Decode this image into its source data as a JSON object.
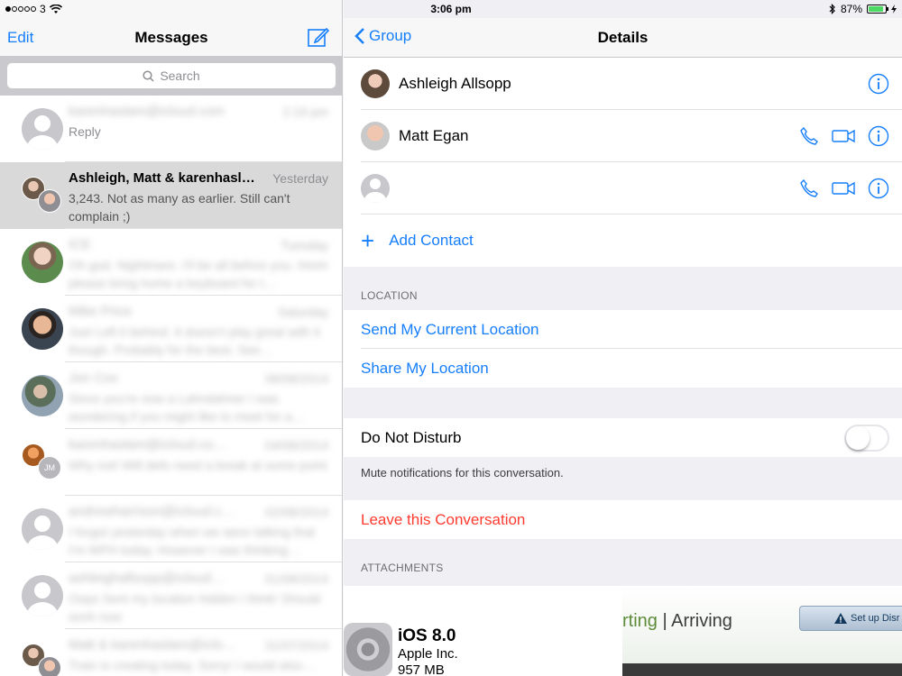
{
  "status": {
    "carrier": "3",
    "time": "3:06 pm",
    "battery": "87%",
    "battery_level": 0.87
  },
  "left_nav": {
    "edit": "Edit",
    "title": "Messages"
  },
  "search": {
    "placeholder": "Search"
  },
  "conversations": [
    {
      "name": "karenhaslam@icloud.com",
      "time": "2:19 pm",
      "preview": "Reply",
      "blurred_name": true,
      "blurred_preview": false,
      "avatar": "placeholder"
    },
    {
      "name": "Ashleigh, Matt & karenhasl…",
      "time": "Yesterday",
      "preview": "3,243. Not as many as earlier. Still can't complain ;)",
      "blurred_name": false,
      "blurred_preview": false,
      "avatar": "group"
    },
    {
      "name": "ICE",
      "time": "Tuesday",
      "preview": "Oh god. Nightmare. I'll be all before you. Hmm please bring home a keyboard for t…",
      "blurred_name": true,
      "blurred_preview": true,
      "avatar": "photo1"
    },
    {
      "name": "Mike Price",
      "time": "Saturday",
      "preview": "Just Left it behind. It doesn't play great with it though. Probably for the best. See…",
      "blurred_name": true,
      "blurred_preview": true,
      "avatar": "photo2"
    },
    {
      "name": "Jon Cox",
      "time": "06/08/2014",
      "preview": "Since you're now a Lahndahner I was wondering if you might like to meet for a…",
      "blurred_name": true,
      "blurred_preview": true,
      "avatar": "photo3"
    },
    {
      "name": "karenhaslam@icloud.co…",
      "time": "04/08/2014",
      "preview": "Why not! Will defo need a break at some point",
      "blurred_name": true,
      "blurred_preview": true,
      "avatar": "group-jm",
      "initials": "JM"
    },
    {
      "name": "andrewharrison@icloud.c…",
      "time": "02/08/2014",
      "preview": "I forgot yesterday when we were talking that I'm WFH today. However I was thinking…",
      "blurred_name": true,
      "blurred_preview": true,
      "avatar": "placeholder"
    },
    {
      "name": "ashleighallsopp@icloud…",
      "time": "01/08/2014",
      "preview": "Oops Sent my location hidden I think! Should work now",
      "blurred_name": true,
      "blurred_preview": true,
      "avatar": "placeholder"
    },
    {
      "name": "Matt & karenhaslam@iclo…",
      "time": "31/07/2014",
      "preview": "Train is creating today. Sorry! I would also…",
      "blurred_name": true,
      "blurred_preview": true,
      "avatar": "group"
    }
  ],
  "right_nav": {
    "back": "Group",
    "title": "Details"
  },
  "contacts": [
    {
      "name": "Ashleigh Allsopp",
      "avatar": "a1",
      "show_call": false
    },
    {
      "name": "Matt Egan",
      "avatar": "a2",
      "show_call": true
    },
    {
      "name": "",
      "avatar": "placeholder",
      "show_call": true
    }
  ],
  "add_contact": "Add Contact",
  "location": {
    "label": "LOCATION",
    "send": "Send My Current Location",
    "share": "Share My Location"
  },
  "dnd": {
    "label": "Do Not Disturb",
    "on": false,
    "note": "Mute notifications for this conversation."
  },
  "leave": "Leave this Conversation",
  "attachments": {
    "label": "ATTACHMENTS",
    "item1": {
      "title": "iOS 8.0",
      "publisher": "Apple Inc.",
      "size": "957 MB"
    },
    "item2": {
      "text_a": "rting",
      "sep": "|",
      "text_b": "Arriving",
      "button": "Set up Disr"
    }
  },
  "colors": {
    "accent": "#157efb",
    "destructive": "#ff3b30",
    "battery": "#4cd964"
  }
}
